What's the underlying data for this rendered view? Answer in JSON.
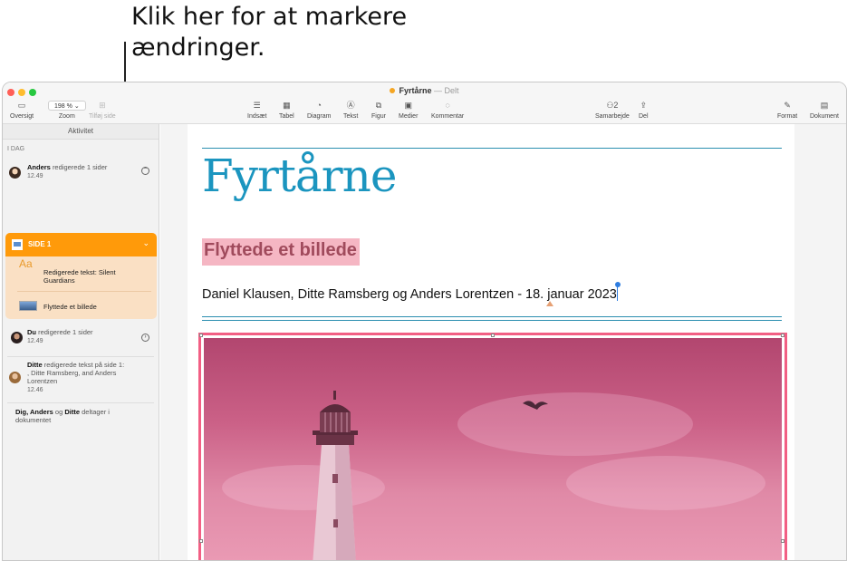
{
  "callout": {
    "line1": "Klik her for at markere",
    "line2": "ændringer."
  },
  "window": {
    "title": "Fyrtårne",
    "title_suffix": "— Delt",
    "status_color": "#f5a623"
  },
  "toolbar": {
    "left": [
      {
        "label": "Oversigt",
        "icon": "sidebar-icon"
      },
      {
        "label": "Zoom",
        "value": "198 %",
        "icon": "chevron-down-icon"
      },
      {
        "label": "Tilføj side",
        "icon": "add-page-icon"
      }
    ],
    "center": [
      {
        "label": "Indsæt",
        "icon": "insert-icon"
      },
      {
        "label": "Tabel",
        "icon": "table-icon"
      },
      {
        "label": "Diagram",
        "icon": "chart-icon"
      },
      {
        "label": "Tekst",
        "icon": "text-box-icon"
      },
      {
        "label": "Figur",
        "icon": "shape-icon"
      },
      {
        "label": "Medier",
        "icon": "media-icon"
      },
      {
        "label": "Kommentar",
        "icon": "comment-icon"
      }
    ],
    "collab": {
      "label": "Samarbejde",
      "count": "2",
      "icon": "collaborate-icon"
    },
    "share": {
      "label": "Del",
      "icon": "share-icon"
    },
    "right": [
      {
        "label": "Format",
        "icon": "paintbrush-icon"
      },
      {
        "label": "Dokument",
        "icon": "document-icon"
      }
    ]
  },
  "sidebar": {
    "header": "Aktivitet",
    "section": "I DAG",
    "entries": [
      {
        "name": "Anders",
        "action": "redigerede 1 sider",
        "time": "12.49"
      },
      {
        "name": "Du",
        "action": "redigerede 1 sider",
        "time": "12.49"
      },
      {
        "name": "Ditte",
        "action": "redigerede tekst på side 1: , Ditte Ramsberg, and Anders Lorentzen",
        "time": "12.46"
      }
    ],
    "page_card": {
      "title": "SIDE 1",
      "items": [
        {
          "text": "Redigerede tekst: Silent Guardians",
          "icon": "text-style-icon"
        },
        {
          "text": "Flyttede et billede",
          "icon": "image-thumbnail-icon"
        }
      ]
    },
    "footer": {
      "names": "Dig, Anders",
      "and": "og",
      "last": "Ditte",
      "rest": "deltager i dokumentet"
    }
  },
  "document": {
    "title": "Fyrtårne",
    "subtitle": "Flyttede et billede",
    "byline": "Daniel Klausen, Ditte Ramsberg og Anders Lorentzen - 18. januar 2023",
    "highlight_color": "#f5b6c3",
    "title_color": "#1b95bf"
  }
}
